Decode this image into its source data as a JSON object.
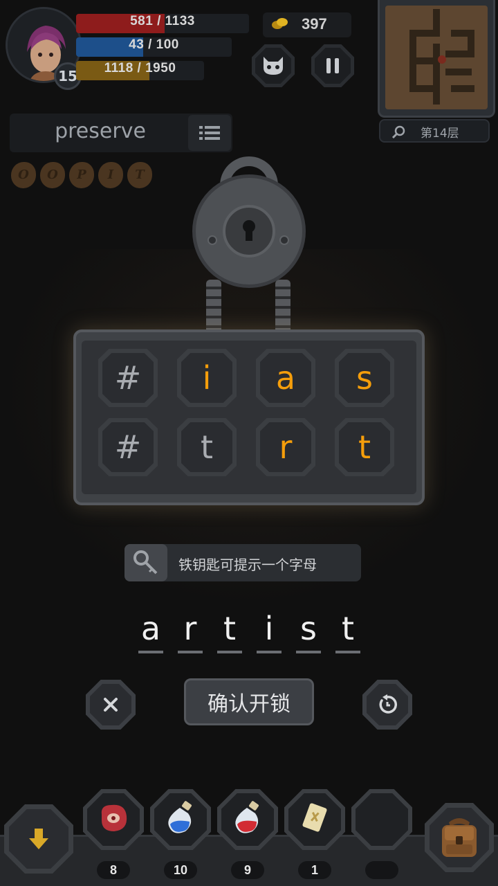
{
  "player": {
    "level": "15",
    "hp": {
      "text": "581 / 1133",
      "current": 581,
      "max": 1133
    },
    "mp": {
      "text": "43 / 100",
      "current": 43,
      "max": 100
    },
    "xp": {
      "text": "1118 / 1950",
      "current": 1118,
      "max": 1950
    }
  },
  "coins": "397",
  "floor": "第14层",
  "target_word": "preserve",
  "runes": [
    "O",
    "O",
    "P",
    "I",
    "T"
  ],
  "board": [
    {
      "letter": "#",
      "used": false
    },
    {
      "letter": "i",
      "used": true
    },
    {
      "letter": "a",
      "used": true
    },
    {
      "letter": "s",
      "used": true
    },
    {
      "letter": "#",
      "used": false
    },
    {
      "letter": "t",
      "used": false
    },
    {
      "letter": "r",
      "used": true
    },
    {
      "letter": "t",
      "used": true
    }
  ],
  "hint": {
    "text": "铁钥匙可提示一个字母"
  },
  "answer": [
    "a",
    "r",
    "t",
    "i",
    "s",
    "t"
  ],
  "buttons": {
    "confirm": "确认开锁"
  },
  "inventory": [
    {
      "icon": "meat-icon",
      "count": "8"
    },
    {
      "icon": "blue-potion-icon",
      "count": "10"
    },
    {
      "icon": "red-potion-icon",
      "count": "9"
    },
    {
      "icon": "scroll-icon",
      "count": "1"
    },
    {
      "icon": "empty-slot",
      "count": ""
    }
  ],
  "colors": {
    "hp": "#8e1c1c",
    "mp": "#1d4f8a",
    "xp": "#7a5a14",
    "letter_used": "#f59e0b",
    "letter_unused": "#a9acb1"
  }
}
